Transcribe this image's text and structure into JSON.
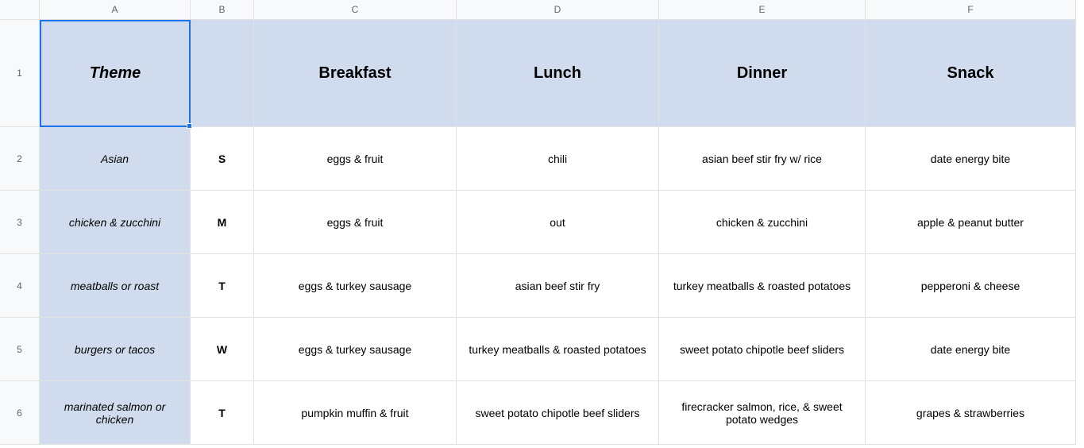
{
  "columns": [
    "A",
    "B",
    "C",
    "D",
    "E",
    "F"
  ],
  "rowNumbers": [
    "1",
    "2",
    "3",
    "4",
    "5",
    "6"
  ],
  "headers": {
    "theme": "Theme",
    "b": "",
    "breakfast": "Breakfast",
    "lunch": "Lunch",
    "dinner": "Dinner",
    "snack": "Snack"
  },
  "rows": [
    {
      "theme": "Asian",
      "day": "S",
      "breakfast": "eggs & fruit",
      "lunch": "chili",
      "dinner": "asian beef stir fry w/ rice",
      "snack": "date energy bite"
    },
    {
      "theme": "chicken & zucchini",
      "day": "M",
      "breakfast": "eggs & fruit",
      "lunch": "out",
      "dinner": "chicken & zucchini",
      "snack": "apple & peanut butter"
    },
    {
      "theme": "meatballs or roast",
      "day": "T",
      "breakfast": "eggs & turkey sausage",
      "lunch": "asian beef stir fry",
      "dinner": "turkey meatballs & roasted potatoes",
      "snack": "pepperoni & cheese"
    },
    {
      "theme": "burgers or tacos",
      "day": "W",
      "breakfast": "eggs & turkey sausage",
      "lunch": "turkey meatballs & roasted potatoes",
      "dinner": "sweet potato chipotle beef sliders",
      "snack": "date energy bite"
    },
    {
      "theme": "marinated salmon or chicken",
      "day": "T",
      "breakfast": "pumpkin muffin & fruit",
      "lunch": "sweet potato chipotle beef sliders",
      "dinner": "firecracker salmon, rice, & sweet potato wedges",
      "snack": "grapes & strawberries"
    }
  ]
}
